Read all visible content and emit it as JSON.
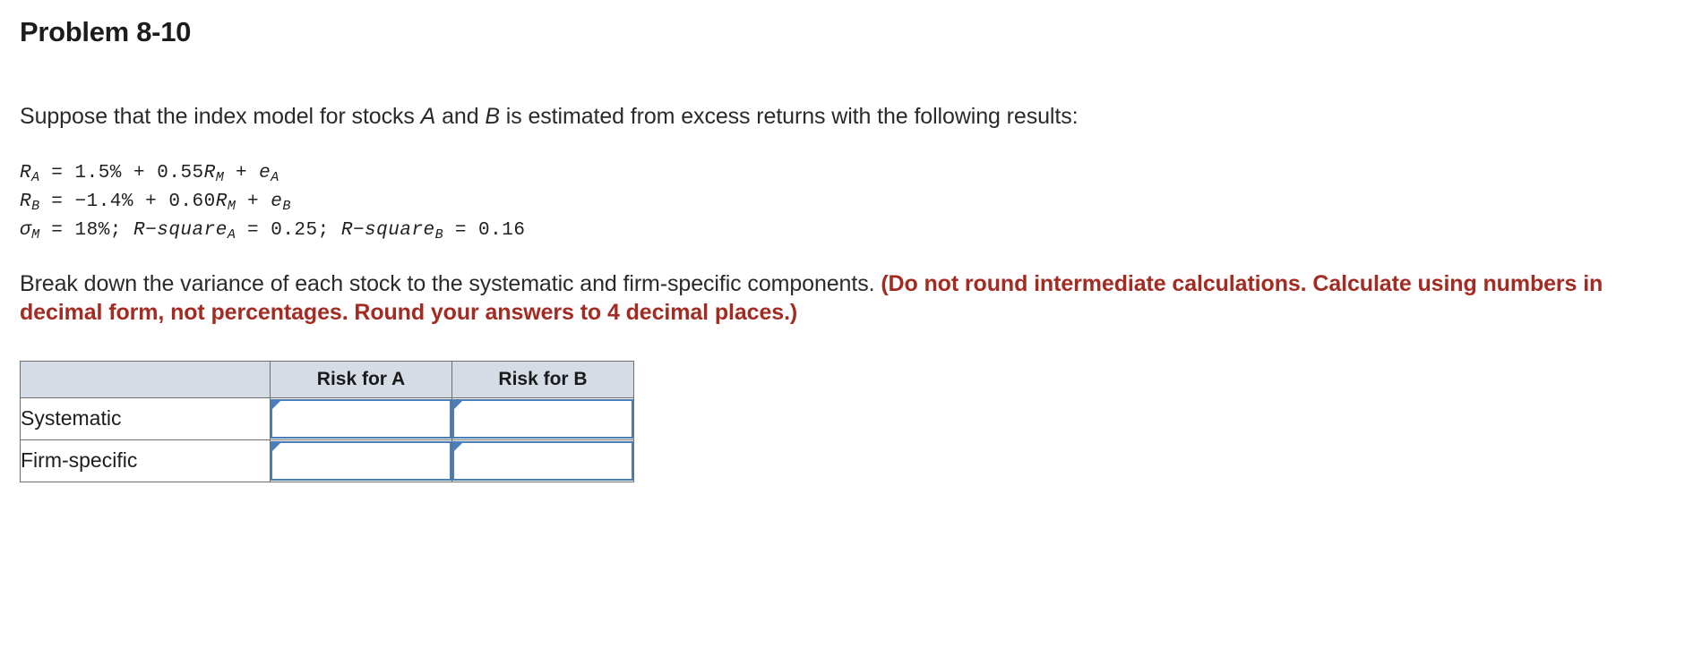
{
  "problem": {
    "title": "Problem 8-10",
    "intro": {
      "part1": "Suppose that the index model for stocks ",
      "var_a": "A",
      "part2": " and ",
      "var_b": "B",
      "part3": " is estimated from excess returns with the following results:"
    },
    "equations": {
      "line1": {
        "lhs_symbol": "R",
        "lhs_sub": "A",
        "eq": " = ",
        "alpha": "1.5%",
        "plus1": " + ",
        "beta": "0.55",
        "market_symbol": "R",
        "market_sub": "M",
        "plus2": " + ",
        "residual_symbol": "e",
        "residual_sub": "A"
      },
      "line2": {
        "lhs_symbol": "R",
        "lhs_sub": "B",
        "eq": " = ",
        "alpha": "−1.4%",
        "plus1": " + ",
        "beta": "0.60",
        "market_symbol": "R",
        "market_sub": "M",
        "plus2": " + ",
        "residual_symbol": "e",
        "residual_sub": "B"
      },
      "line3": {
        "sigma_symbol": "σ",
        "sigma_sub": "M",
        "sigma_eq": " = 18%;  ",
        "rsq_a_label": "R−square",
        "rsq_a_sub": "A",
        "rsq_a_value": " = 0.25;  ",
        "rsq_b_label": "R−square",
        "rsq_b_sub": "B",
        "rsq_b_value": " = 0.16"
      }
    },
    "prompt": {
      "main": "Break down the variance of each stock to the systematic and firm-specific components. ",
      "note": "(Do not round intermediate calculations. Calculate using numbers in decimal form, not percentages. Round your answers to 4 decimal places.)"
    }
  },
  "answer_table": {
    "headers": [
      "",
      "Risk for A",
      "Risk for B"
    ],
    "rows": [
      {
        "label": "Systematic",
        "risk_a": "",
        "risk_b": "",
        "placeholder_a": "",
        "placeholder_b": ""
      },
      {
        "label": "Firm-specific",
        "risk_a": "",
        "risk_b": "",
        "placeholder_a": "",
        "placeholder_b": ""
      }
    ]
  },
  "colors": {
    "header_fill": "#d6dce6",
    "table_border": "#6f6f6f",
    "input_border": "#4a7ebb",
    "note_red": "#a32b22"
  }
}
